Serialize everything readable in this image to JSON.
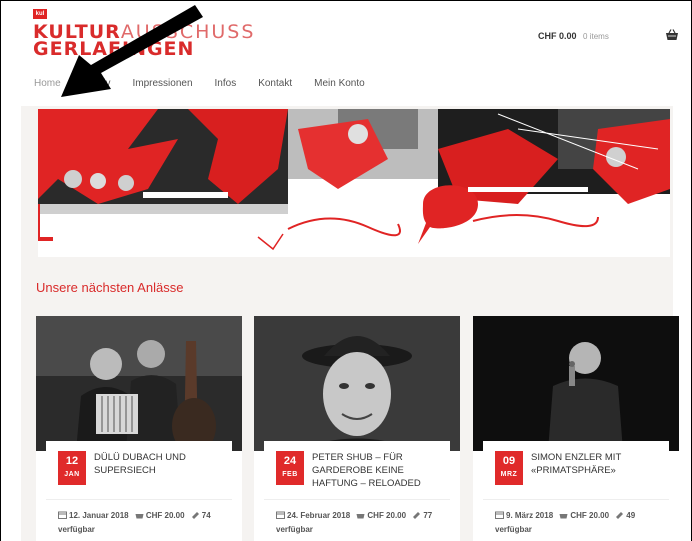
{
  "header": {
    "logo_badge": "kul",
    "logo_line1_bold": "KULTUR",
    "logo_line1_light": "AUSSCHUSS",
    "logo_line2_bold": "GERLAFINGEN",
    "cart_total": "CHF 0.00",
    "cart_items": "0 items"
  },
  "nav": {
    "items": [
      {
        "label": "Home"
      },
      {
        "label": "Archiv"
      },
      {
        "label": "Impressionen"
      },
      {
        "label": "Infos"
      },
      {
        "label": "Kontakt"
      },
      {
        "label": "Mein Konto"
      }
    ]
  },
  "section": {
    "title": "Unsere nächsten Anlässe"
  },
  "events": [
    {
      "day": "12",
      "month": "JAN",
      "title": "DÜLÜ DUBACH UND SUPERSIECH",
      "date": "12. Januar 2018",
      "price": "CHF 20.00",
      "available": "74 verfügbar"
    },
    {
      "day": "24",
      "month": "FEB",
      "title": "PETER SHUB – FÜR GARDEROBE KEINE HAFTUNG – RELOADED",
      "date": "24. Februar 2018",
      "price": "CHF 20.00",
      "available": "77 verfügbar"
    },
    {
      "day": "09",
      "month": "MRZ",
      "title": "SIMON ENZLER MIT «PRIMATSPHÄRE»",
      "date": "9. März 2018",
      "price": "CHF 20.00",
      "available": "49 verfügbar"
    }
  ],
  "colors": {
    "accent": "#d92b2b",
    "badge": "#e02a2a"
  }
}
